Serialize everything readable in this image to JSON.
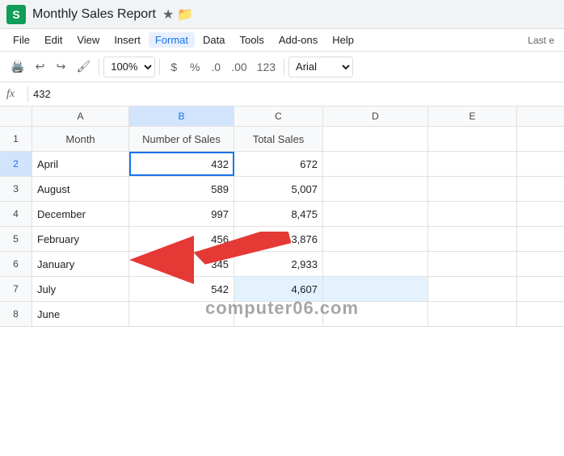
{
  "titleBar": {
    "appName": "Monthly Sales Report",
    "logoLetter": "S",
    "starIcon": "★",
    "folderIcon": "📁"
  },
  "menuBar": {
    "items": [
      "File",
      "Edit",
      "View",
      "Insert",
      "Format",
      "Data",
      "Tools",
      "Add-ons",
      "Help"
    ],
    "activeItem": "Format",
    "lastEdit": "Last e"
  },
  "toolbar": {
    "zoom": "100%",
    "currency": "$",
    "percent": "%",
    "decimal1": ".0",
    "decimal2": ".00",
    "moreFormats": "123",
    "font": "Arial"
  },
  "formulaBar": {
    "icon": "fx",
    "value": "432"
  },
  "columns": {
    "headers": [
      "",
      "A",
      "B",
      "C",
      "D",
      "E"
    ],
    "colB": "B",
    "selectedCol": "B"
  },
  "rows": [
    {
      "rowNum": "1",
      "cells": [
        "Month",
        "Number of Sales",
        "Total Sales",
        "",
        ""
      ]
    },
    {
      "rowNum": "2",
      "cells": [
        "April",
        "432",
        "672",
        "",
        ""
      ],
      "selected": true
    },
    {
      "rowNum": "3",
      "cells": [
        "August",
        "589",
        "5,007",
        "",
        ""
      ]
    },
    {
      "rowNum": "4",
      "cells": [
        "December",
        "997",
        "8,475",
        "",
        ""
      ]
    },
    {
      "rowNum": "5",
      "cells": [
        "February",
        "456",
        "3,876",
        "",
        ""
      ]
    },
    {
      "rowNum": "6",
      "cells": [
        "January",
        "345",
        "2,933",
        "",
        ""
      ]
    },
    {
      "rowNum": "7",
      "cells": [
        "July",
        "542",
        "4,607",
        "",
        ""
      ],
      "highlighted": true
    },
    {
      "rowNum": "8",
      "cells": [
        "June",
        "",
        "",
        "",
        ""
      ]
    }
  ],
  "watermark": "computer06.com",
  "arrow": {
    "pointing": "B2"
  }
}
